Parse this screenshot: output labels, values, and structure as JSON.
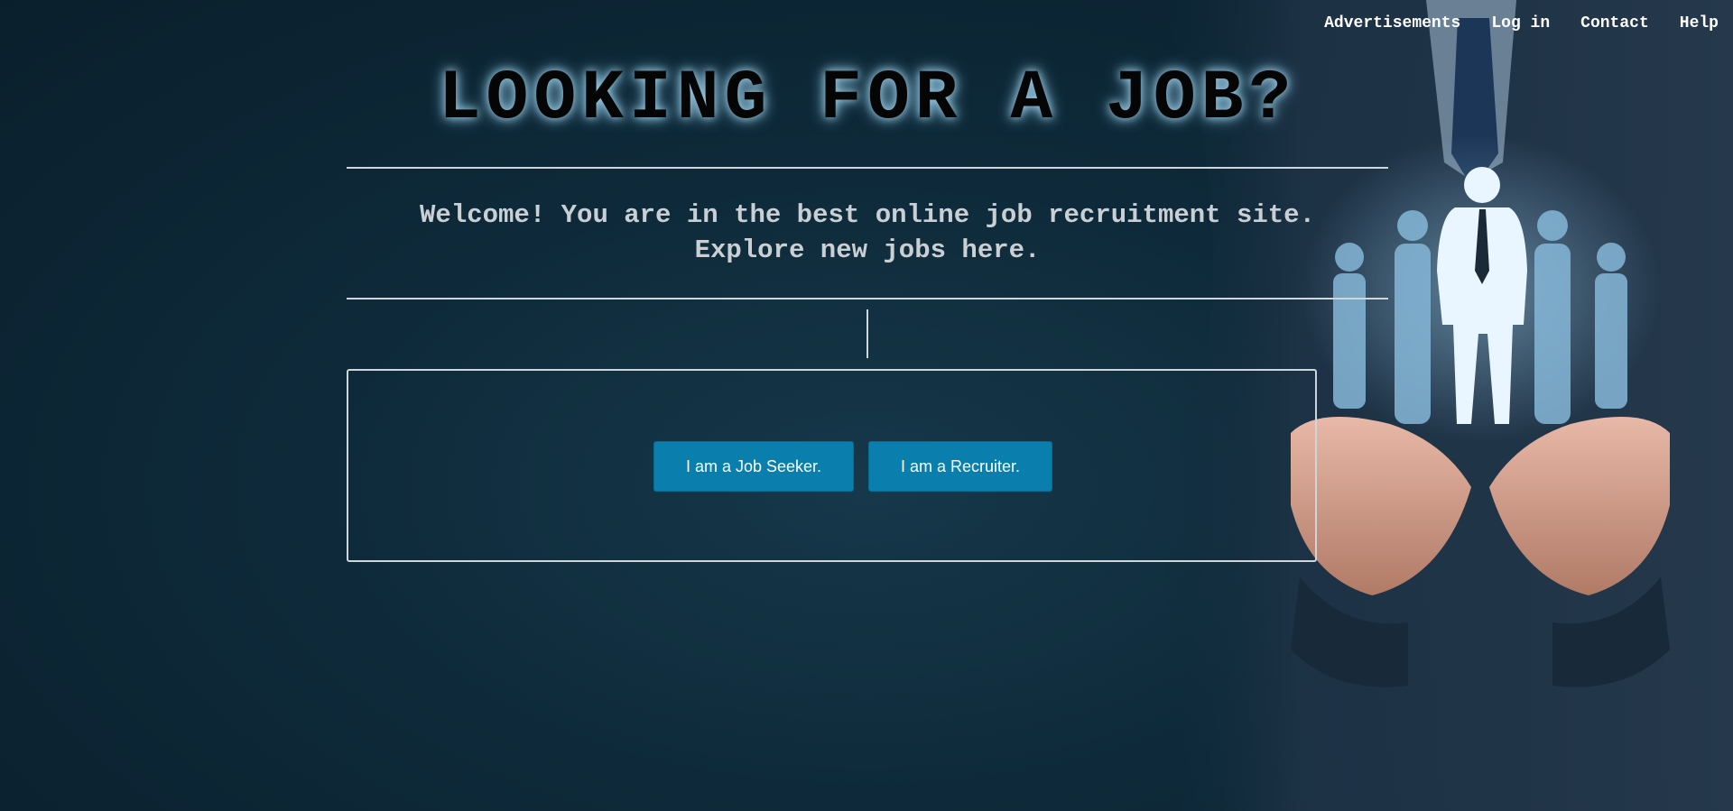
{
  "nav": {
    "items": [
      {
        "label": "Advertisements"
      },
      {
        "label": "Log in"
      },
      {
        "label": "Contact"
      },
      {
        "label": "Help"
      }
    ]
  },
  "hero": {
    "title": "LOOKING FOR A JOB?"
  },
  "welcome": {
    "line1": "Welcome! You are in the best online job recruitment site.",
    "line2": "Explore new jobs here."
  },
  "buttons": {
    "job_seeker": "I am a Job Seeker.",
    "recruiter": "I am a Recruiter."
  },
  "colors": {
    "background": "#0e2a3a",
    "button": "#0a7fae",
    "rule": "#cfd6da"
  }
}
